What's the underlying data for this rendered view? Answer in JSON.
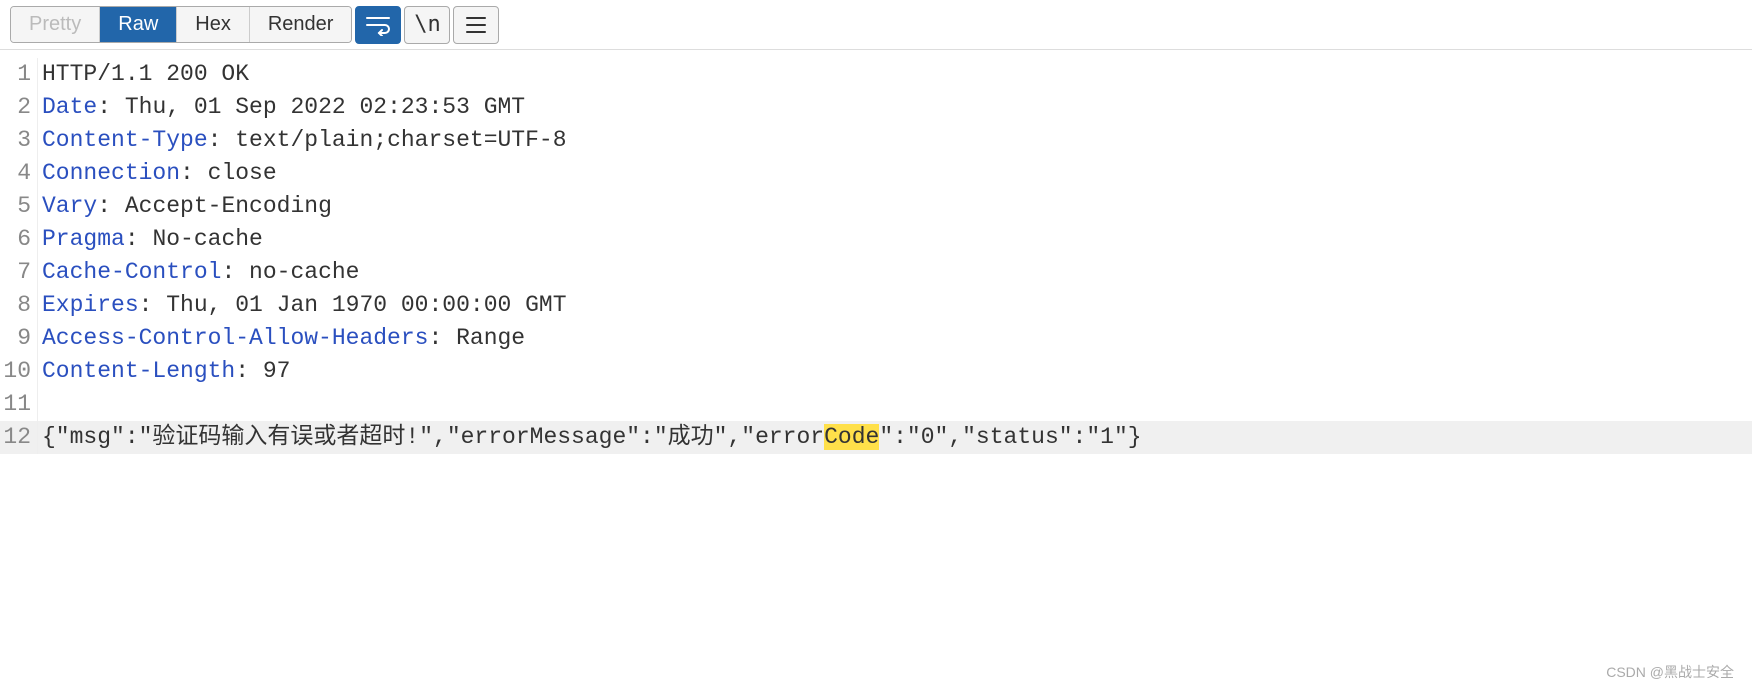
{
  "tabs": {
    "pretty": "Pretty",
    "raw": "Raw",
    "hex": "Hex",
    "render": "Render"
  },
  "lines": [
    {
      "n": "1",
      "plain": "HTTP/1.1 200 OK"
    },
    {
      "n": "2",
      "key": "Date",
      "sep": ":",
      "val": " Thu, 01 Sep 2022 02:23:53 GMT"
    },
    {
      "n": "3",
      "key": "Content-Type",
      "sep": ":",
      "val": " text/plain;charset=UTF-8"
    },
    {
      "n": "4",
      "key": "Connection",
      "sep": ":",
      "val": " close"
    },
    {
      "n": "5",
      "key": "Vary",
      "sep": ":",
      "val": " Accept-Encoding"
    },
    {
      "n": "6",
      "key": "Pragma",
      "sep": ":",
      "val": " No-cache"
    },
    {
      "n": "7",
      "key": "Cache-Control",
      "sep": ":",
      "val": " no-cache"
    },
    {
      "n": "8",
      "key": "Expires",
      "sep": ":",
      "val": " Thu, 01 Jan 1970 00:00:00 GMT"
    },
    {
      "n": "9",
      "key": "Access-Control-Allow-Headers",
      "sep": ":",
      "val": " Range"
    },
    {
      "n": "10",
      "key": "Content-Length",
      "sep": ":",
      "val": " 97"
    },
    {
      "n": "11",
      "plain": ""
    },
    {
      "n": "12",
      "body_pre": "{\"msg\":\"验证码输入有误或者超时!\",\"errorMessage\":\"成功\",\"error",
      "body_match": "Code",
      "body_post": "\":\"0\",\"status\":\"1\"}"
    }
  ],
  "watermark": "CSDN @黑战士安全"
}
